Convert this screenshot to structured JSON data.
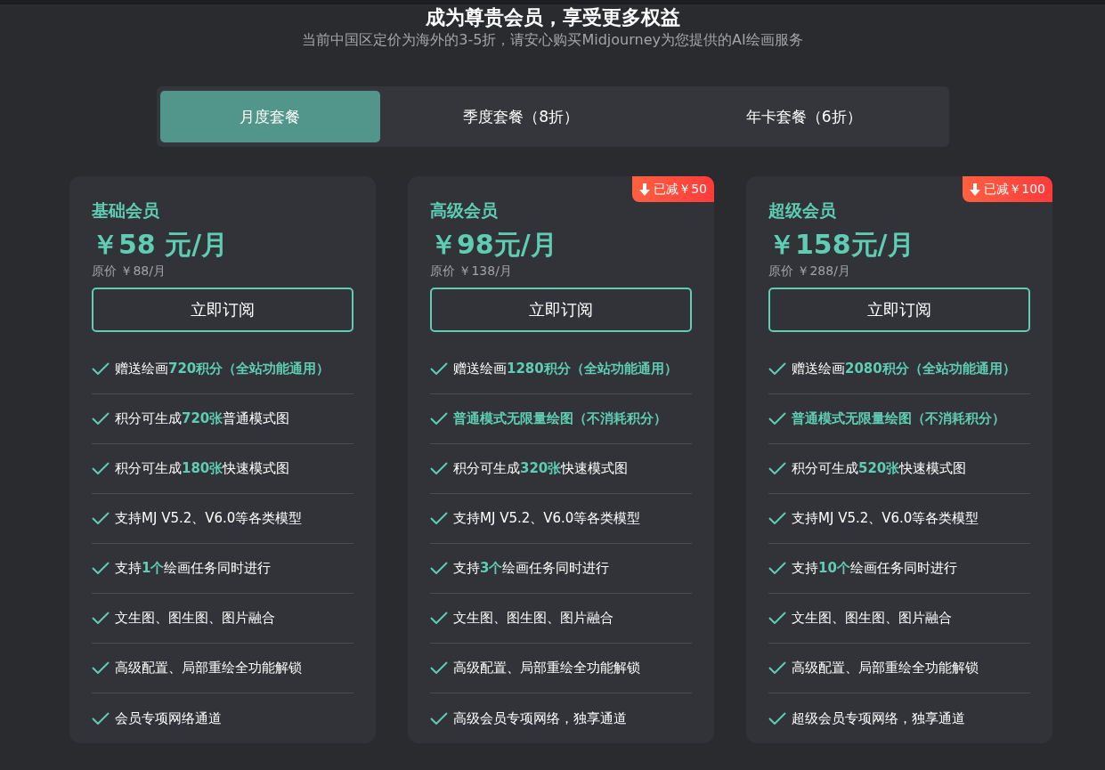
{
  "header": {
    "title": "成为尊贵会员，享受更多权益",
    "subtitle": "当前中国区定价为海外的3-5折，请安心购买Midjourney为您提供的AI绘画服务"
  },
  "tabs": [
    {
      "label": "月度套餐",
      "selected": true
    },
    {
      "label": "季度套餐（8折）",
      "selected": false
    },
    {
      "label": "年卡套餐（6折）",
      "selected": false
    }
  ],
  "plans": [
    {
      "name": "基础会员",
      "price": "￥58 元/月",
      "original_price": "原价 ￥88/月",
      "button": "立即订阅",
      "features": [
        {
          "text": "赠送绘画**720积分（全站功能通用）**",
          "emphasis": false
        },
        {
          "text": "积分可生成**720张**普通模式图",
          "emphasis": false
        },
        {
          "text": "积分可生成**180张**快速模式图",
          "emphasis": false
        },
        {
          "text": "支持MJ V5.2、V6.0等各类模型",
          "emphasis": false
        },
        {
          "text": "支持**1个**绘画任务同时进行",
          "emphasis": false
        },
        {
          "text": "文生图、图生图、图片融合",
          "emphasis": false
        },
        {
          "text": "高级配置、局部重绘全功能解锁",
          "emphasis": false
        },
        {
          "text": "会员专项网络通道",
          "emphasis": false
        }
      ]
    },
    {
      "name": "高级会员",
      "discount": "已减￥50",
      "price": "￥98元/月",
      "original_price": "原价 ￥138/月",
      "button": "立即订阅",
      "features": [
        {
          "text": "赠送绘画**1280积分（全站功能通用）**",
          "emphasis": false
        },
        {
          "text": "普通模式无限量绘图（不消耗积分）",
          "emphasis": true
        },
        {
          "text": "积分可生成**320张**快速模式图",
          "emphasis": false
        },
        {
          "text": "支持MJ V5.2、V6.0等各类模型",
          "emphasis": false
        },
        {
          "text": "支持**3个**绘画任务同时进行",
          "emphasis": false
        },
        {
          "text": "文生图、图生图、图片融合",
          "emphasis": false
        },
        {
          "text": "高级配置、局部重绘全功能解锁",
          "emphasis": false
        },
        {
          "text": "高级会员专项网络，独享通道",
          "emphasis": false
        }
      ]
    },
    {
      "name": "超级会员",
      "discount": "已减￥100",
      "price": "￥158元/月",
      "original_price": "原价 ￥288/月",
      "button": "立即订阅",
      "features": [
        {
          "text": "赠送绘画**2080积分（全站功能通用）**",
          "emphasis": false
        },
        {
          "text": "普通模式无限量绘图（不消耗积分）",
          "emphasis": true
        },
        {
          "text": "积分可生成**520张**快速模式图",
          "emphasis": false
        },
        {
          "text": "支持MJ V5.2、V6.0等各类模型",
          "emphasis": false
        },
        {
          "text": "支持**10个**绘画任务同时进行",
          "emphasis": false
        },
        {
          "text": "文生图、图生图、图片融合",
          "emphasis": false
        },
        {
          "text": "高级配置、局部重绘全功能解锁",
          "emphasis": false
        },
        {
          "text": "超级会员专项网络，独享通道",
          "emphasis": false
        }
      ]
    }
  ]
}
